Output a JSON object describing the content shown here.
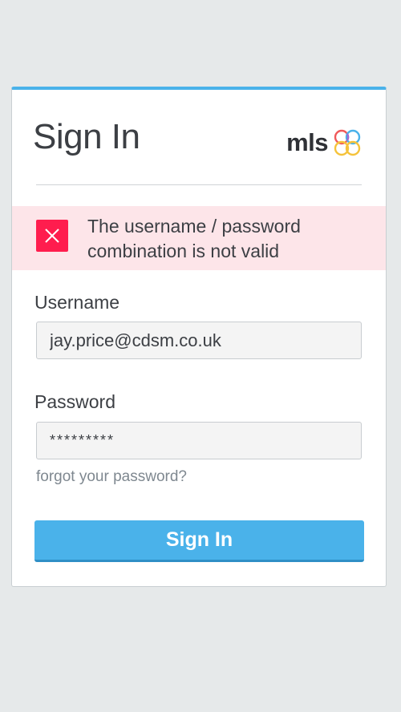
{
  "page": {
    "title": "Sign In",
    "brand": "mls"
  },
  "error": {
    "message": "The username / password combination is not valid",
    "icon": "close-icon"
  },
  "form": {
    "username_label": "Username",
    "username_value": "jay.price@cdsm.co.uk",
    "password_label": "Password",
    "password_value": "*********",
    "forgot_link": "forgot your password?",
    "submit_label": "Sign In"
  },
  "colors": {
    "accent": "#4ab2ea",
    "error_bg": "#fde5e9",
    "error_icon": "#ff1d4e",
    "logo_red": "#f05a5b",
    "logo_blue": "#4ab2ea",
    "logo_yellow": "#f5c33b",
    "logo_purple": "#9b6bd6"
  }
}
